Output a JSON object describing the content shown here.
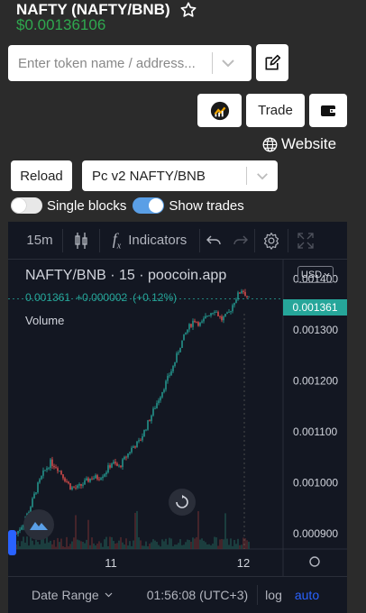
{
  "header": {
    "title": "NAFTY (NAFTY/BNB)",
    "price": "$0.00136106"
  },
  "search": {
    "placeholder": "Enter token name / address..."
  },
  "actions": {
    "trade_label": "Trade",
    "website_label": "Website",
    "reload_label": "Reload",
    "pair_select_value": "Pc v2 NAFTY/BNB"
  },
  "toggles": {
    "single_blocks": {
      "label": "Single blocks",
      "on": false
    },
    "show_trades": {
      "label": "Show trades",
      "on": true
    }
  },
  "chart_toolbar": {
    "interval": "15m",
    "indicators_label": "Indicators"
  },
  "legend": {
    "title": "NAFTY/BNB · 15 · poocoin.app",
    "last": "0.001361",
    "change": "+0.000002",
    "change_pct": "(+0.12%)",
    "volume_label": "Volume"
  },
  "price_axis": {
    "currency": "USD",
    "current_price": "0.001361",
    "ticks": [
      "0.001400",
      "0.001300",
      "0.001200",
      "0.001100",
      "0.001000",
      "0.000900"
    ]
  },
  "time_axis": {
    "ticks": [
      "11",
      "12"
    ]
  },
  "bottom_bar": {
    "date_range_label": "Date Range",
    "clock": "01:56:08 (UTC+3)",
    "log_label": "log",
    "auto_label": "auto"
  },
  "colors": {
    "price_green": "#2fa84f",
    "up_candle": "#26a69a",
    "down_candle": "#ef5350",
    "chart_bg": "#131722",
    "accent_blue": "#2962ff"
  },
  "chart_data": {
    "type": "candlestick",
    "y_axis_ticks": [
      0.0014,
      0.0013,
      0.0012,
      0.0011,
      0.001,
      0.0009
    ],
    "ylim": [
      0.00087,
      0.00142
    ],
    "last_price": 0.001361,
    "x_ticks": [
      "11",
      "12"
    ],
    "close_series": [
      0.0009,
      0.00092,
      0.00095,
      0.00099,
      0.00102,
      0.00104,
      0.00103,
      0.00101,
      0.00099,
      0.00099,
      0.001,
      0.00101,
      0.00101,
      0.00102,
      0.00104,
      0.00103,
      0.00105,
      0.00107,
      0.00108,
      0.00111,
      0.00114,
      0.00117,
      0.0012,
      0.00123,
      0.00127,
      0.0013,
      0.00132,
      0.00131,
      0.00133,
      0.00134,
      0.00132,
      0.00133,
      0.00136,
      0.00138,
      0.00136
    ]
  }
}
